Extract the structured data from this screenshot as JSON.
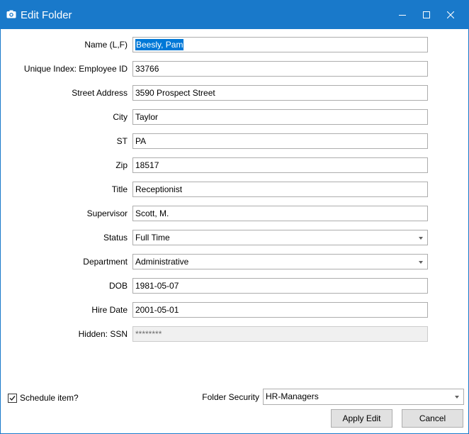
{
  "window": {
    "title": "Edit Folder",
    "accent_color": "#1979ca",
    "icons": {
      "app": "camera-icon",
      "minimize": "minimize-icon",
      "maximize": "maximize-icon",
      "close": "close-icon"
    }
  },
  "fields": [
    {
      "label": "Name (L,F)",
      "value": "Beesly, Pam",
      "type": "text",
      "selected": true
    },
    {
      "label": "Unique Index: Employee ID",
      "value": "33766",
      "type": "text"
    },
    {
      "label": "Street Address",
      "value": "3590 Prospect Street",
      "type": "text"
    },
    {
      "label": "City",
      "value": "Taylor",
      "type": "text"
    },
    {
      "label": "ST",
      "value": "PA",
      "type": "text"
    },
    {
      "label": "Zip",
      "value": "18517",
      "type": "text"
    },
    {
      "label": "Title",
      "value": "Receptionist",
      "type": "text"
    },
    {
      "label": "Supervisor",
      "value": "Scott, M.",
      "type": "text"
    },
    {
      "label": "Status",
      "value": "Full Time",
      "type": "select"
    },
    {
      "label": "Department",
      "value": "Administrative",
      "type": "select"
    },
    {
      "label": "DOB",
      "value": "1981-05-07",
      "type": "text"
    },
    {
      "label": "Hire Date",
      "value": "2001-05-01",
      "type": "text"
    },
    {
      "label": "Hidden: SSN",
      "value": "********",
      "type": "text",
      "disabled": true
    }
  ],
  "footer": {
    "schedule_label": "Schedule item?",
    "schedule_checked": true,
    "security_label": "Folder Security",
    "security_value": "HR-Managers",
    "apply_label": "Apply Edit",
    "cancel_label": "Cancel"
  }
}
